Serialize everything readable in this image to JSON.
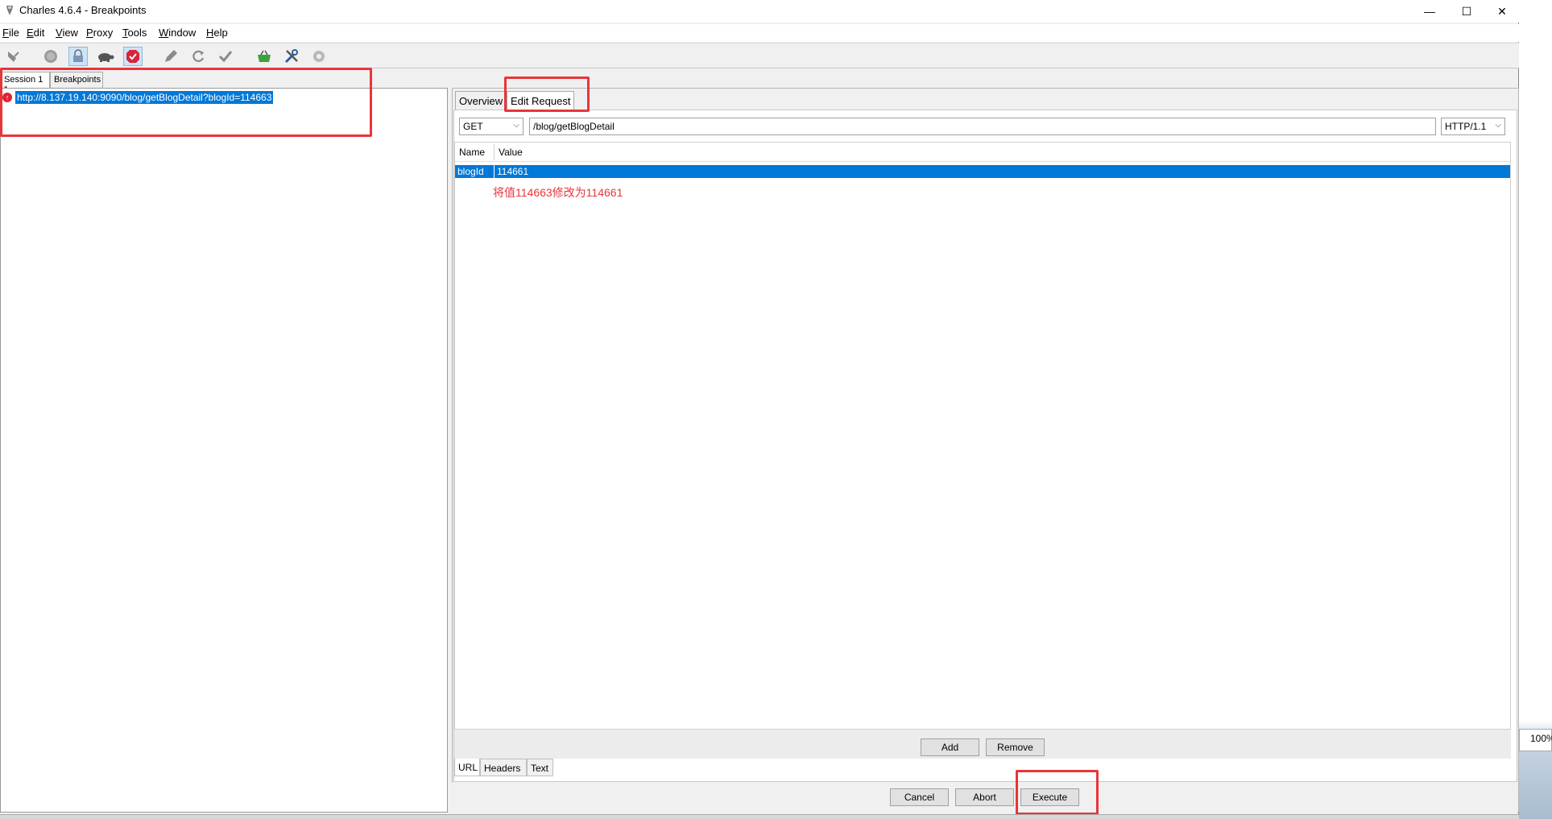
{
  "window": {
    "title": "Charles 4.6.4 - Breakpoints",
    "minimize_glyph": "—",
    "maximize_glyph": "☐",
    "close_glyph": "✕"
  },
  "menu": [
    {
      "label": "File",
      "mnemonic": "F",
      "rest": "ile"
    },
    {
      "label": "Edit",
      "mnemonic": "E",
      "rest": "dit"
    },
    {
      "label": "View",
      "mnemonic": "V",
      "rest": "iew"
    },
    {
      "label": "Proxy",
      "mnemonic": "P",
      "rest": "roxy"
    },
    {
      "label": "Tools",
      "mnemonic": "T",
      "rest": "ools"
    },
    {
      "label": "Window",
      "mnemonic": "W",
      "rest": "indow"
    },
    {
      "label": "Help",
      "mnemonic": "H",
      "rest": "elp"
    }
  ],
  "toolbar": {
    "icons": [
      "broom-icon",
      "record-icon",
      "ssl-proxy-icon",
      "throttle-turtle-icon",
      "breakpoints-icon",
      "compose-pen-icon",
      "repeat-icon",
      "validate-check-icon",
      "basket-icon",
      "tools-icon",
      "settings-gear-icon"
    ]
  },
  "left": {
    "tabs": [
      "Session 1 *",
      "Breakpoints"
    ],
    "tree_item": "http://8.137.19.140:9090/blog/getBlogDetail?blogId=114663"
  },
  "right": {
    "tabs": [
      "Overview",
      "Edit Request"
    ],
    "method": "GET",
    "path": "/blog/getBlogDetail",
    "protocol": "HTTP/1.1",
    "columns": [
      "Name",
      "Value"
    ],
    "rows": [
      {
        "name": "blogId",
        "value": "114661"
      }
    ],
    "annotation": "将值114663修改为114661",
    "add_label": "Add",
    "remove_label": "Remove",
    "bottom_tabs": [
      "URL",
      "Headers",
      "Text"
    ],
    "cancel_label": "Cancel",
    "abort_label": "Abort",
    "execute_label": "Execute"
  },
  "desktop": {
    "zoom_text": "100%"
  },
  "colors": {
    "selection": "#0078d7",
    "annotation": "#e8353a"
  }
}
